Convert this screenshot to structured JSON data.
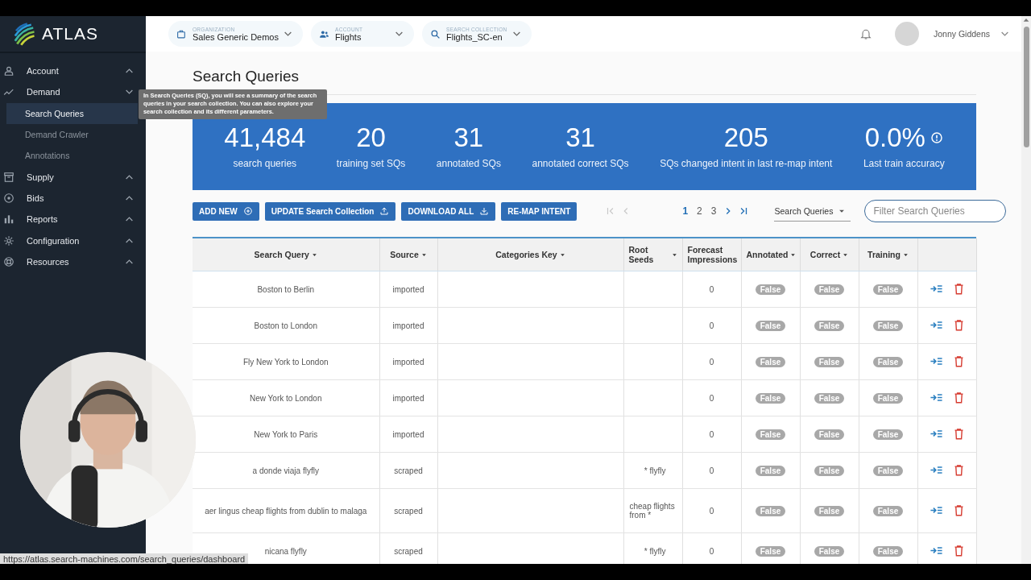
{
  "sidebar": {
    "logo": "ATLAS",
    "items": [
      {
        "label": "Account",
        "expanded": false
      },
      {
        "label": "Demand",
        "expanded": true,
        "children": [
          {
            "label": "Search Queries",
            "selected": true
          },
          {
            "label": "Demand Crawler",
            "selected": false
          },
          {
            "label": "Annotations",
            "selected": false
          }
        ]
      },
      {
        "label": "Supply",
        "expanded": false
      },
      {
        "label": "Bids",
        "expanded": false
      },
      {
        "label": "Reports",
        "expanded": false
      },
      {
        "label": "Configuration",
        "expanded": false
      },
      {
        "label": "Resources",
        "expanded": false
      }
    ]
  },
  "topbar": {
    "selectors": [
      {
        "label": "ORGANIZATION",
        "value": "Sales Generic Demos"
      },
      {
        "label": "ACCOUNT",
        "value": "Flights"
      },
      {
        "label": "SEARCH COLLECTION",
        "value": "Flights_SC-en"
      }
    ],
    "user": "Jonny Giddens"
  },
  "page_title": "Search Queries",
  "tooltip": "In Search Queries (SQ), you will see a summary of the search queries in your search collection. You can also explore your search collection and its different parameters.",
  "stats": [
    {
      "value": "41,484",
      "label": "search queries",
      "info": false
    },
    {
      "value": "20",
      "label": "training set SQs",
      "info": false
    },
    {
      "value": "31",
      "label": "annotated SQs",
      "info": false
    },
    {
      "value": "31",
      "label": "annotated correct SQs",
      "info": false
    },
    {
      "value": "205",
      "label": "SQs changed intent in last re-map intent",
      "info": false
    },
    {
      "value": "0.0%",
      "label": "Last train accuracy",
      "info": true
    }
  ],
  "actions": [
    {
      "label": "ADD NEW",
      "kind": "plus"
    },
    {
      "label": "UPDATE Search Collection",
      "kind": "upload"
    },
    {
      "label": "DOWNLOAD ALL",
      "kind": "download"
    },
    {
      "label": "RE-MAP INTENT",
      "kind": "plain"
    }
  ],
  "pagination": {
    "first_disabled": true,
    "pages": [
      {
        "label": "1",
        "selected": true
      },
      {
        "label": "2",
        "selected": false
      },
      {
        "label": "3",
        "selected": false
      }
    ]
  },
  "view_select": "Search Queries",
  "filter": {
    "placeholder": "Filter Search Queries"
  },
  "table": {
    "columns": [
      "Search Query",
      "Source",
      "Categories Key",
      "Root Seeds",
      "Forecast Impressions",
      "Annotated",
      "Correct",
      "Training"
    ],
    "rows": [
      {
        "query": "Boston to Berlin",
        "source": "imported",
        "impressions": "0",
        "annotated": "False",
        "correct": "False",
        "training": "False"
      },
      {
        "query": "Boston to London",
        "source": "imported",
        "impressions": "0",
        "annotated": "False",
        "correct": "False",
        "training": "False"
      },
      {
        "query": "Fly New York to London",
        "source": "imported",
        "impressions": "0",
        "annotated": "False",
        "correct": "False",
        "training": "False"
      },
      {
        "query": "New York to London",
        "source": "imported",
        "impressions": "0",
        "annotated": "False",
        "correct": "False",
        "training": "False"
      },
      {
        "query": "New York to Paris",
        "source": "imported",
        "impressions": "0",
        "annotated": "False",
        "correct": "False",
        "training": "False"
      },
      {
        "query": "a donde viaja flyfly",
        "source": "scraped",
        "root_seeds": "* flyfly",
        "impressions": "0",
        "annotated": "False",
        "correct": "False",
        "training": "False"
      },
      {
        "query": "aer lingus cheap flights from dublin to malaga",
        "source": "scraped",
        "root_seeds": "cheap flights from *",
        "impressions": "0",
        "annotated": "False",
        "correct": "False",
        "training": "False"
      },
      {
        "query": "nicana flyfly",
        "source": "scraped",
        "root_seeds": "* flyfly",
        "impressions": "0",
        "annotated": "False",
        "correct": "False",
        "training": "False"
      }
    ]
  },
  "status_url": "https://atlas.search-machines.com/search_queries/dashboard"
}
